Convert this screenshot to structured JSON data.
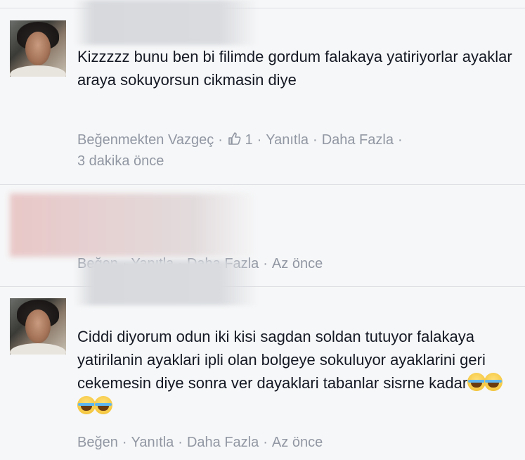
{
  "comments": [
    {
      "text": "Kizzzzz bunu ben bi filimde gordum falakaya yatiriyorlar ayaklar araya sokuyorsun cikmasin diye",
      "actions": {
        "unlike": "Beğenmekten Vazgeç",
        "like_count": "1",
        "reply": "Yanıtla",
        "more": "Daha Fazla",
        "time": "3 dakika önce"
      }
    },
    {
      "actions": {
        "like": "Beğen",
        "reply": "Yanıtla",
        "more": "Daha Fazla",
        "time": "Az önce"
      }
    },
    {
      "text": "Ciddi diyorum odun iki kisi sagdan soldan tutuyor falakaya yatirilanin ayaklari ipli olan bolgeye sokuluyor ayaklarini geri cekemesin diye sonra ver dayaklari tabanlar sisrne kadar",
      "emoji": [
        "tears-of-joy-emoji",
        "tears-of-joy-emoji",
        "tears-of-joy-emoji",
        "tears-of-joy-emoji"
      ],
      "actions": {
        "like": "Beğen",
        "reply": "Yanıtla",
        "more": "Daha Fazla",
        "time": "Az önce"
      }
    }
  ]
}
